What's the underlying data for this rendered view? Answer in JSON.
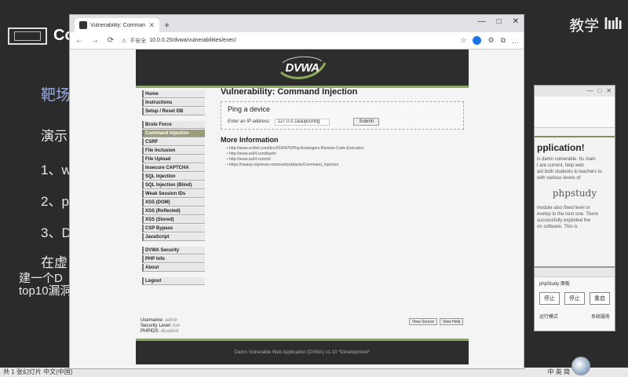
{
  "slide": {
    "title": "Co",
    "brand_cn": "教学",
    "brand_logo": "lıılı",
    "heading": "靶场",
    "intro": "演示",
    "item1": "1、w",
    "item2": "2、p",
    "item3": "3、D",
    "para1": "在虚",
    "para2": "建一个D",
    "para3": "top10漏洞"
  },
  "bg_window": {
    "title": "pplication!",
    "lines": [
      "is damn vulnerable. Its main",
      "t are current, help web",
      "aid both students & teachers to",
      "",
      "with various levels of"
    ],
    "php_logo": "phpstudy",
    "lines2": [
      "module also fixed level or",
      "evelop to the next one. There",
      "successfully exploited the",
      "",
      "on software. This is"
    ]
  },
  "php_window": {
    "title": "phpStudy 面板",
    "buttons": [
      "停止",
      "停止",
      "重启"
    ],
    "option1": "运行模式",
    "option2": "系统服务"
  },
  "taskbar": {
    "left": "共 1 张幻灯片  中文(中国)",
    "right": "中 英 简"
  },
  "browser": {
    "tab_title": "Vulnerability: Command Injection",
    "new_tab": "+",
    "win_controls": [
      "—",
      "□",
      "✕"
    ],
    "nav": [
      "←",
      "→",
      "⟳"
    ],
    "security_label": "不安全",
    "url": "10.0.0.25/dvwa/vulnerabilities/exec/",
    "toolbar_icons": [
      "☆",
      "⚙",
      "⧉",
      "…"
    ]
  },
  "dvwa": {
    "logo": "DVWA",
    "menu": {
      "group1": [
        "Home",
        "Instructions",
        "Setup / Reset DB"
      ],
      "group2": [
        "Brute Force",
        "Command Injection",
        "CSRF",
        "File Inclusion",
        "File Upload",
        "Insecure CAPTCHA",
        "SQL Injection",
        "SQL Injection (Blind)",
        "Weak Session IDs",
        "XSS (DOM)",
        "XSS (Reflected)",
        "XSS (Stored)",
        "CSP Bypass",
        "JavaScript"
      ],
      "group3": [
        "DVWA Security",
        "PHP Info",
        "About"
      ],
      "group4": [
        "Logout"
      ]
    },
    "active_menu": "Command Injection",
    "page_title": "Vulnerability: Command Injection",
    "ping": {
      "title": "Ping a device",
      "label": "Enter an IP address:",
      "value": "127.0.0.1&&ipconfig",
      "submit": "Submit"
    },
    "more_info_title": "More Information",
    "links": [
      "http://www.scribd.com/doc/2530476/Php-Endangers-Remote-Code-Execution",
      "http://www.ss64.com/bash/",
      "http://www.ss64.com/nt/",
      "https://owasp.org/www-community/attacks/Command_Injection"
    ],
    "meta": {
      "username_label": "Username:",
      "username": "admin",
      "security_label": "Security Level:",
      "security": "low",
      "phpids_label": "PHPIDS:",
      "phpids": "disabled"
    },
    "view_source": "View Source",
    "view_help": "View Help",
    "footer": "Damn Vulnerable Web Application (DVWA) v1.10 *Development*"
  },
  "colors": {
    "dvwa_green": "#8bad58",
    "dvwa_dark": "#2d2d2d",
    "menu_active": "#9c9c7a"
  }
}
